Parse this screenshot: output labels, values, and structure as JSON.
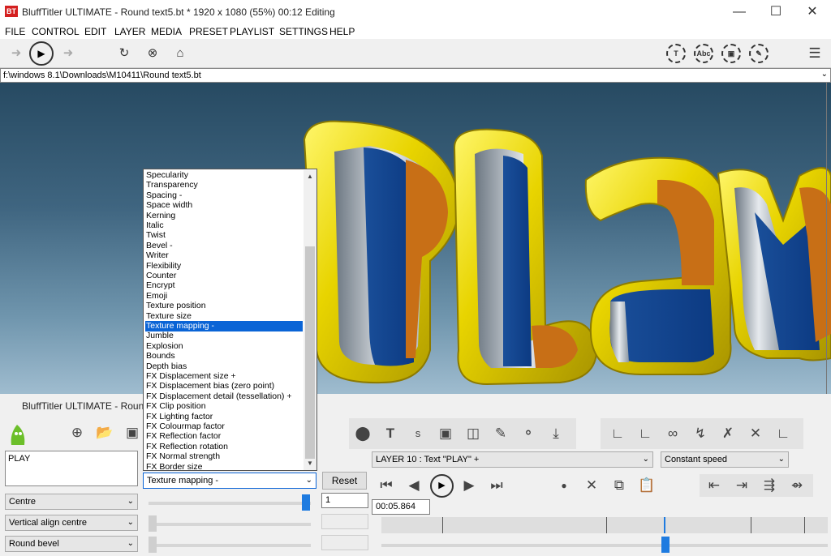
{
  "window": {
    "title": "BluffTitler ULTIMATE  - Round text5.bt * 1920 x 1080 (55%) 00:12 Editing",
    "logo": "BT"
  },
  "menu": [
    "FILE",
    "CONTROL",
    "EDIT",
    "LAYER",
    "MEDIA",
    "PRESET",
    "PLAYLIST",
    "SETTINGS",
    "HELP"
  ],
  "path": "f:\\windows 8.1\\Downloads\\M10411\\Round text5.bt",
  "preview_text": "PLAY",
  "panel_title": "BluffTitler ULTIMATE  - Round",
  "property_list": [
    "Specularity",
    "Transparency",
    "Spacing -",
    "Space width",
    "Kerning",
    "Italic",
    "Twist",
    "Bevel -",
    "Writer",
    "Flexibility",
    "Counter",
    "Encrypt",
    "Emoji",
    "Texture position",
    "Texture size",
    "Texture mapping -",
    "Jumble",
    "Explosion",
    "Bounds",
    "Depth bias",
    "FX Displacement size +",
    "FX Displacement bias (zero point)",
    "FX Displacement detail (tessellation) +",
    "FX Clip position",
    "FX Lighting factor",
    "FX Colourmap factor",
    "FX Reflection factor",
    "FX Reflection rotation",
    "FX Normal strength",
    "FX Border size"
  ],
  "selected_property_index": 15,
  "property_combo_value": "Texture mapping -",
  "reset_label": "Reset",
  "layer_combo": "LAYER    10   : Text \"PLAY\" +",
  "speed_combo": "Constant speed",
  "value_input": "1",
  "time_input": "00:05.864",
  "left_combos": [
    "Centre",
    "Vertical align centre",
    "Round bevel"
  ],
  "slider_value": 1.0,
  "colors": {
    "selection": "#0a64d6",
    "accent": "#1e7be0"
  }
}
